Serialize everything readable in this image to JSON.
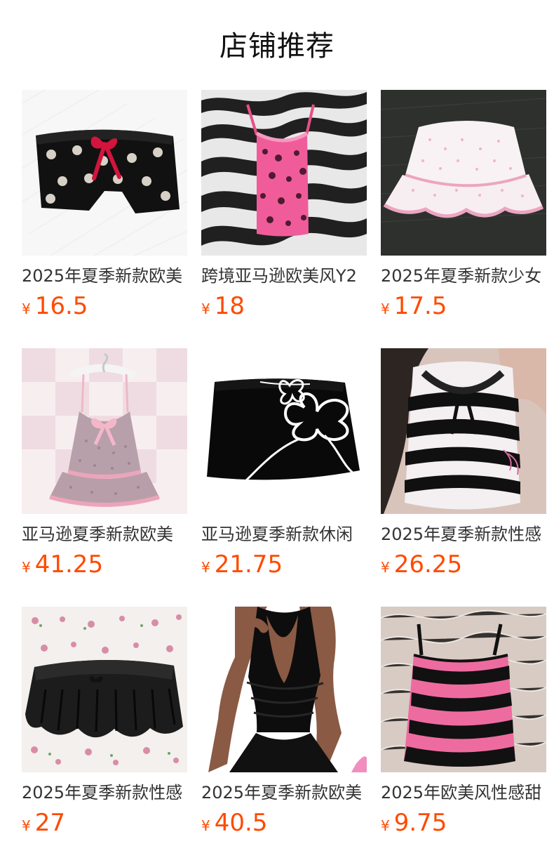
{
  "page": {
    "title": "店铺推荐"
  },
  "products": [
    {
      "title": "2025年夏季新款欧美",
      "currency": "¥",
      "price": "16.5",
      "icon": "skull-shorts-image"
    },
    {
      "title": "跨境亚马逊欧美风Y2",
      "currency": "¥",
      "price": "18",
      "icon": "leopard-top-image"
    },
    {
      "title": "2025年夏季新款少女",
      "currency": "¥",
      "price": "17.5",
      "icon": "ruffle-skirt-image"
    },
    {
      "title": "亚马逊夏季新款欧美",
      "currency": "¥",
      "price": "41.25",
      "icon": "pink-slip-dress-image"
    },
    {
      "title": "亚马逊夏季新款休闲",
      "currency": "¥",
      "price": "21.75",
      "icon": "black-floral-skirt-image"
    },
    {
      "title": "2025年夏季新款性感",
      "currency": "¥",
      "price": "26.25",
      "icon": "striped-lace-top-image"
    },
    {
      "title": "2025年夏季新款性感",
      "currency": "¥",
      "price": "27",
      "icon": "black-pleated-skort-image"
    },
    {
      "title": "2025年夏季新款欧美",
      "currency": "¥",
      "price": "40.5",
      "icon": "black-halter-dress-image"
    },
    {
      "title": "2025年欧美风性感甜",
      "currency": "¥",
      "price": "9.75",
      "icon": "pink-striped-cami-image"
    }
  ],
  "colors": {
    "price": "#ff4a00",
    "title": "#111111",
    "text": "#333333"
  }
}
